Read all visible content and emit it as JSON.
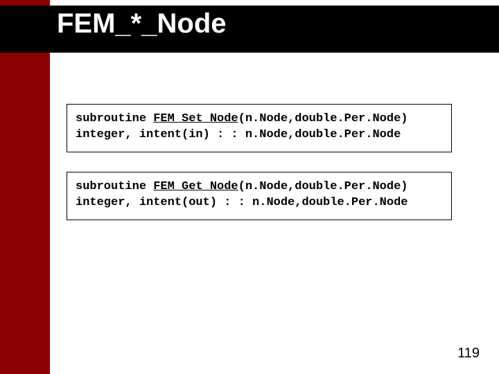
{
  "title": "FEM_*_Node",
  "code_blocks": [
    {
      "line1_prefix": "subroutine ",
      "line1_name": "FEM_Set_Node",
      "line1_suffix": "(n.Node,double.Per.Node)",
      "line2": "integer, intent(in) : : n.Node,double.Per.Node"
    },
    {
      "line1_prefix": "subroutine ",
      "line1_name": "FEM_Get_Node",
      "line1_suffix": "(n.Node,double.Per.Node)",
      "line2": "integer, intent(out) : : n.Node,double.Per.Node"
    }
  ],
  "page_number": "119"
}
